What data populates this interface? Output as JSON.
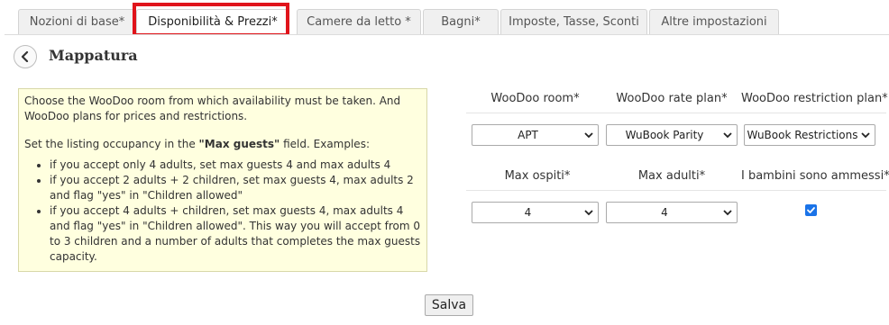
{
  "tabs": [
    {
      "label": "Nozioni di base*"
    },
    {
      "label": "Disponibilità & Prezzi*"
    },
    {
      "label": "Camere da letto *"
    },
    {
      "label": "Bagni*"
    },
    {
      "label": "Imposte, Tasse, Sconti"
    },
    {
      "label": "Altre impostazioni"
    }
  ],
  "page": {
    "title": "Mappatura"
  },
  "info": {
    "para1": "Choose the WooDoo room from which availability must be taken. And WooDoo plans for prices and restrictions.",
    "para2_before": "Set the listing occupancy in the ",
    "para2_bold": "\"Max guests\"",
    "para2_after": " field. Examples:",
    "bullets": [
      "if you accept only 4 adults, set max guests 4 and max adults 4",
      "if you accept 2 adults + 2 children, set max guests 4, max adults 2 and flag \"yes\" in \"Children allowed\"",
      "if you accept 4 adults + children, set max guests 4, max adults 4 and flag \"yes\" in \"Children allowed\". This way you will accept from 0 to 3 children and a number of adults that completes the max guests capacity."
    ]
  },
  "form": {
    "room_label": "WooDoo room*",
    "rate_label": "WooDoo rate plan*",
    "restriction_label": "WooDoo restriction plan*",
    "room_value": "APT",
    "rate_value": "WuBook Parity",
    "restriction_value": "WuBook Restrictions",
    "max_guests_label": "Max ospiti*",
    "max_adults_label": "Max adulti*",
    "children_label": "I bambini sono ammessi*",
    "max_guests_value": "4",
    "max_adults_value": "4",
    "children_allowed": true
  },
  "actions": {
    "save_label": "Salva"
  },
  "colors": {
    "highlight": "#e0141b",
    "checkbox": "#1a73e8",
    "infobox_bg": "#ffffdf"
  }
}
